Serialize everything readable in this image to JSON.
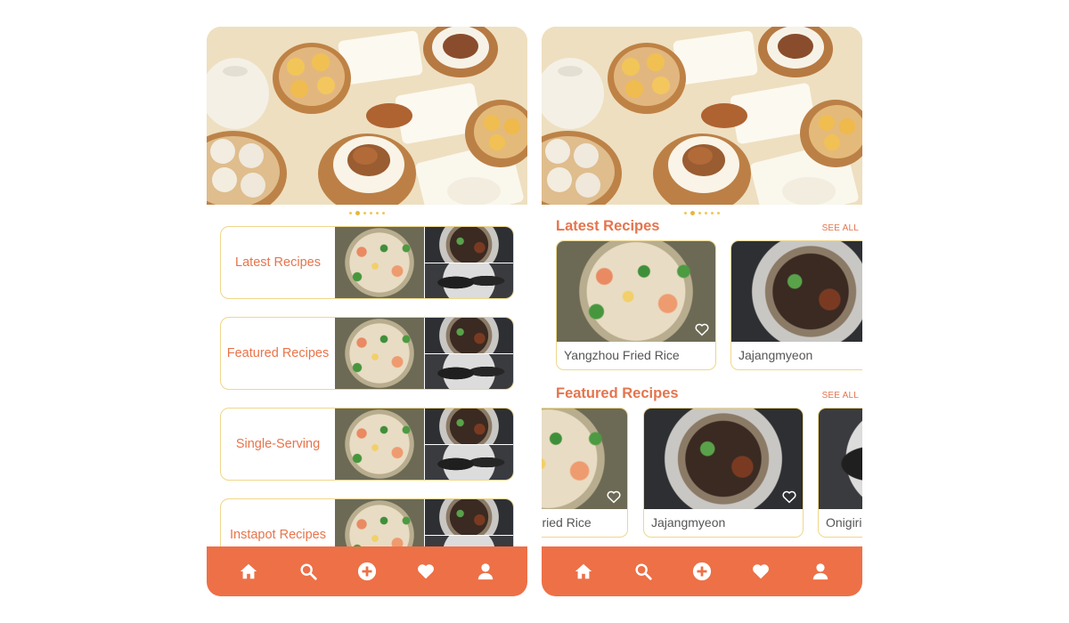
{
  "left": {
    "categories": [
      {
        "label": "Latest Recipes"
      },
      {
        "label": "Featured Recipes"
      },
      {
        "label": "Single-Serving"
      },
      {
        "label": "Instapot Recipes"
      }
    ],
    "carousel": {
      "count": 6,
      "active": 1
    }
  },
  "right": {
    "carousel": {
      "count": 6,
      "active": 1
    },
    "latest": {
      "title": "Latest Recipes",
      "see_all": "SEE ALL",
      "items": [
        {
          "name": "Yangzhou Fried Rice",
          "photo": "fried-rice"
        },
        {
          "name": "Jajangmyeon",
          "photo": "jajangmyeon"
        }
      ]
    },
    "featured": {
      "title": "Featured Recipes",
      "see_all": "SEE ALL",
      "items": [
        {
          "name": "Yangzhou Fried Rice",
          "photo": "fried-rice"
        },
        {
          "name": "Jajangmyeon",
          "photo": "jajangmyeon"
        },
        {
          "name": "Onigiri",
          "photo": "onigiri"
        }
      ]
    }
  },
  "nav": {
    "items": [
      "home-icon",
      "search-icon",
      "add-icon",
      "heart-icon",
      "profile-icon"
    ]
  },
  "colors": {
    "accent": "#ed7047",
    "title": "#e5744d",
    "card_border": "#efd78b",
    "dot": "#f1c65a"
  }
}
